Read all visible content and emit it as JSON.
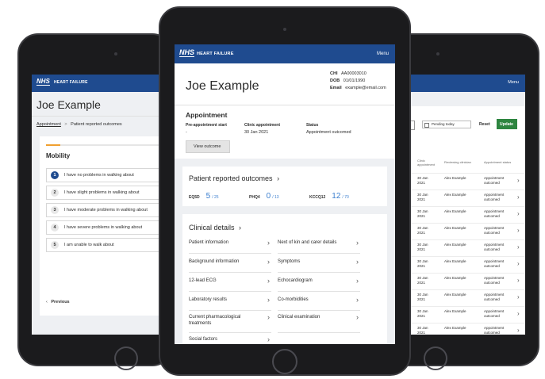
{
  "brand": {
    "logo_text": "NHS",
    "logo_sub": "SCOTLAND",
    "app_title": "HEART FAILURE",
    "menu_label": "Menu"
  },
  "left_screen": {
    "patient_name": "Joe Example",
    "breadcrumb": {
      "root": "Appointment",
      "separator": ">",
      "current": "Patient reported outcomes"
    },
    "section_title": "Mobility",
    "options": [
      {
        "num": "1",
        "text": "I have no problems in walking about",
        "selected": true
      },
      {
        "num": "2",
        "text": "I have slight problems in walking about",
        "selected": false
      },
      {
        "num": "3",
        "text": "I have moderate problems in walking about",
        "selected": false
      },
      {
        "num": "4",
        "text": "I have severe problems in walking about",
        "selected": false
      },
      {
        "num": "5",
        "text": "I am unable to walk about",
        "selected": false
      }
    ],
    "previous_label": "Previous",
    "progress_fraction": 0.12
  },
  "center_screen": {
    "patient_name": "Joe Example",
    "chi_label": "CHI",
    "chi_value": "AA00003010",
    "dob_label": "DOB",
    "dob_value": "01/01/1990",
    "email_label": "Email",
    "email_value": "example@email.com",
    "appointment_title": "Appointment",
    "pre_appt_label": "Pre-appointment start",
    "pre_appt_value": "-",
    "clinic_label": "Clinic appointment",
    "clinic_value": "30 Jan 2021",
    "status_label": "Status",
    "status_value": "Appointment outcomed",
    "view_outcome_button": "View outcome",
    "pro_title": "Patient reported outcomes",
    "scores": [
      {
        "name": "EQ5D",
        "value": "5",
        "max": "/ 25"
      },
      {
        "name": "PHQ4",
        "value": "0",
        "max": "/ 13"
      },
      {
        "name": "KCCQ12",
        "value": "12",
        "max": "/ 70"
      }
    ],
    "clinical_title": "Clinical details",
    "clinical_items": [
      [
        "Patient information",
        "Next of kin and carer details"
      ],
      [
        "Background information",
        "Symptoms"
      ],
      [
        "12-lead ECG",
        "Echocardiogram"
      ],
      [
        "Laboratory results",
        "Co-morbidities"
      ],
      [
        "Current pharmacological treatments",
        "Clinical examination"
      ],
      [
        "Social factors",
        ""
      ]
    ]
  },
  "right_screen": {
    "filter_label": "Pending today",
    "reset_label": "Reset",
    "update_label": "Update",
    "columns": [
      "Clinic appointment",
      "Reviewing clinician",
      "Appointment status"
    ],
    "rows": [
      [
        "30 Jan 2021",
        "Alex Example",
        "Appointment outcomed"
      ],
      [
        "30 Jan 2021",
        "Alex Example",
        "Appointment outcomed"
      ],
      [
        "30 Jan 2021",
        "Alex Example",
        "Appointment outcomed"
      ],
      [
        "30 Jan 2021",
        "Alex Example",
        "Appointment outcomed"
      ],
      [
        "30 Jan 2021",
        "Alex Example",
        "Appointment outcomed"
      ],
      [
        "30 Jan 2021",
        "Alex Example",
        "Appointment outcomed"
      ],
      [
        "30 Jan 2021",
        "Alex Example",
        "Appointment outcomed"
      ],
      [
        "30 Jan 2021",
        "Alex Example",
        "Appointment outcomed"
      ],
      [
        "30 Jan 2021",
        "Alex Example",
        "Appointment outcomed"
      ],
      [
        "30 Jan 2021",
        "Alex Example",
        "Appointment outcomed"
      ],
      [
        "30 Jan 2021",
        "Alex Example",
        "Appointment"
      ]
    ]
  },
  "colors": {
    "nhs_blue": "#1f4b8f",
    "accent_orange": "#f0a030",
    "score_blue": "#3c7fcf",
    "update_green": "#2e8540"
  }
}
